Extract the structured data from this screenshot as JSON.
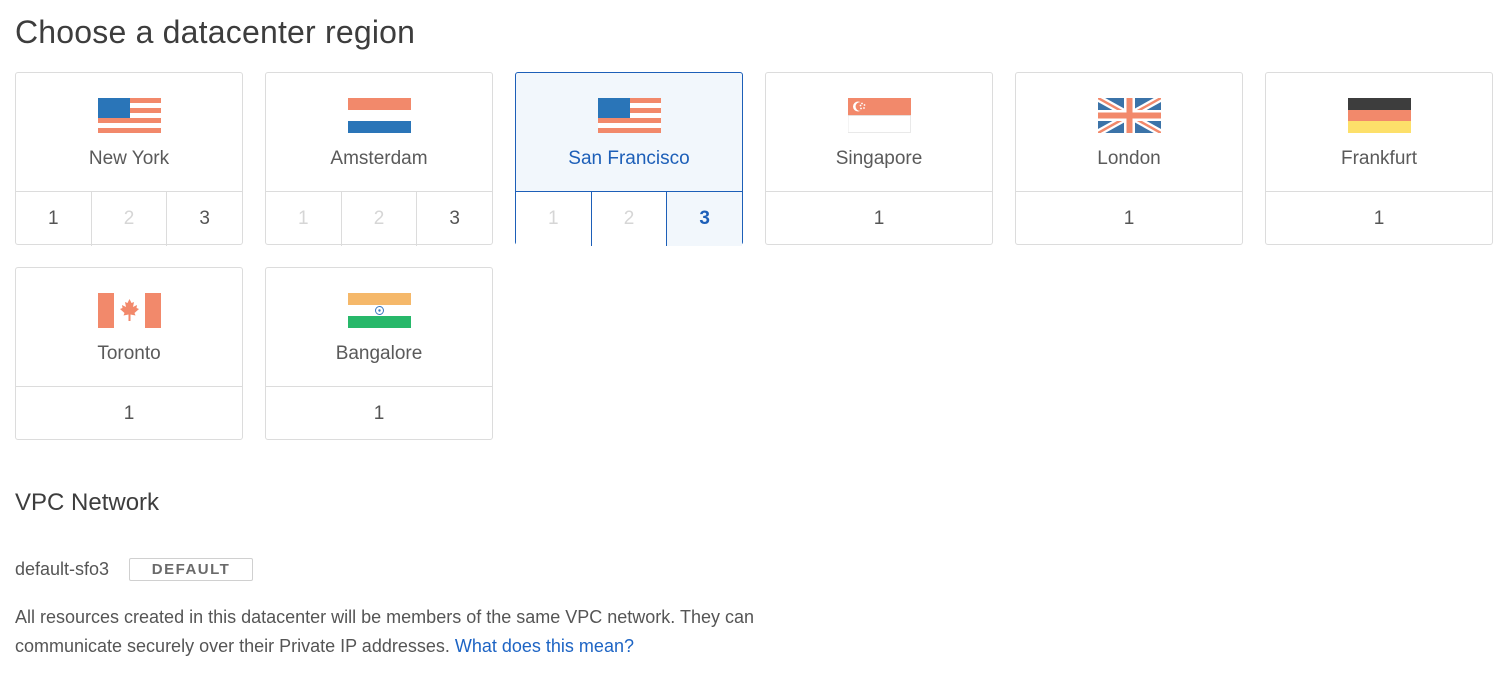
{
  "heading": "Choose a datacenter region",
  "regions": [
    {
      "name": "New York",
      "flag": "us-flag-icon",
      "selected": false,
      "datacenters": [
        {
          "n": "1",
          "available": true
        },
        {
          "n": "2",
          "available": false
        },
        {
          "n": "3",
          "available": true
        }
      ]
    },
    {
      "name": "Amsterdam",
      "flag": "netherlands-flag-icon",
      "selected": false,
      "datacenters": [
        {
          "n": "1",
          "available": false
        },
        {
          "n": "2",
          "available": false
        },
        {
          "n": "3",
          "available": true
        }
      ]
    },
    {
      "name": "San Francisco",
      "flag": "us-flag-icon",
      "selected": true,
      "selected_datacenter": "3",
      "datacenters": [
        {
          "n": "1",
          "available": false
        },
        {
          "n": "2",
          "available": false
        },
        {
          "n": "3",
          "available": true
        }
      ]
    },
    {
      "name": "Singapore",
      "flag": "singapore-flag-icon",
      "selected": false,
      "datacenters": [
        {
          "n": "1",
          "available": true
        }
      ]
    },
    {
      "name": "London",
      "flag": "uk-flag-icon",
      "selected": false,
      "datacenters": [
        {
          "n": "1",
          "available": true
        }
      ]
    },
    {
      "name": "Frankfurt",
      "flag": "germany-flag-icon",
      "selected": false,
      "datacenters": [
        {
          "n": "1",
          "available": true
        }
      ]
    },
    {
      "name": "Toronto",
      "flag": "canada-flag-icon",
      "selected": false,
      "datacenters": [
        {
          "n": "1",
          "available": true
        }
      ]
    },
    {
      "name": "Bangalore",
      "flag": "india-flag-icon",
      "selected": false,
      "datacenters": [
        {
          "n": "1",
          "available": true
        }
      ]
    }
  ],
  "vpc": {
    "title": "VPC Network",
    "network_name": "default-sfo3",
    "badge": "DEFAULT",
    "description": "All resources created in this datacenter will be members of the same VPC network. They can communicate securely over their Private IP addresses.",
    "link_text": "What does this mean?"
  },
  "colors": {
    "accent": "#1d5fb8",
    "selected_bg": "#f2f7fc",
    "border": "#dcdcdc",
    "disabled_text": "#d6d6d6",
    "link": "#1d64c4"
  }
}
